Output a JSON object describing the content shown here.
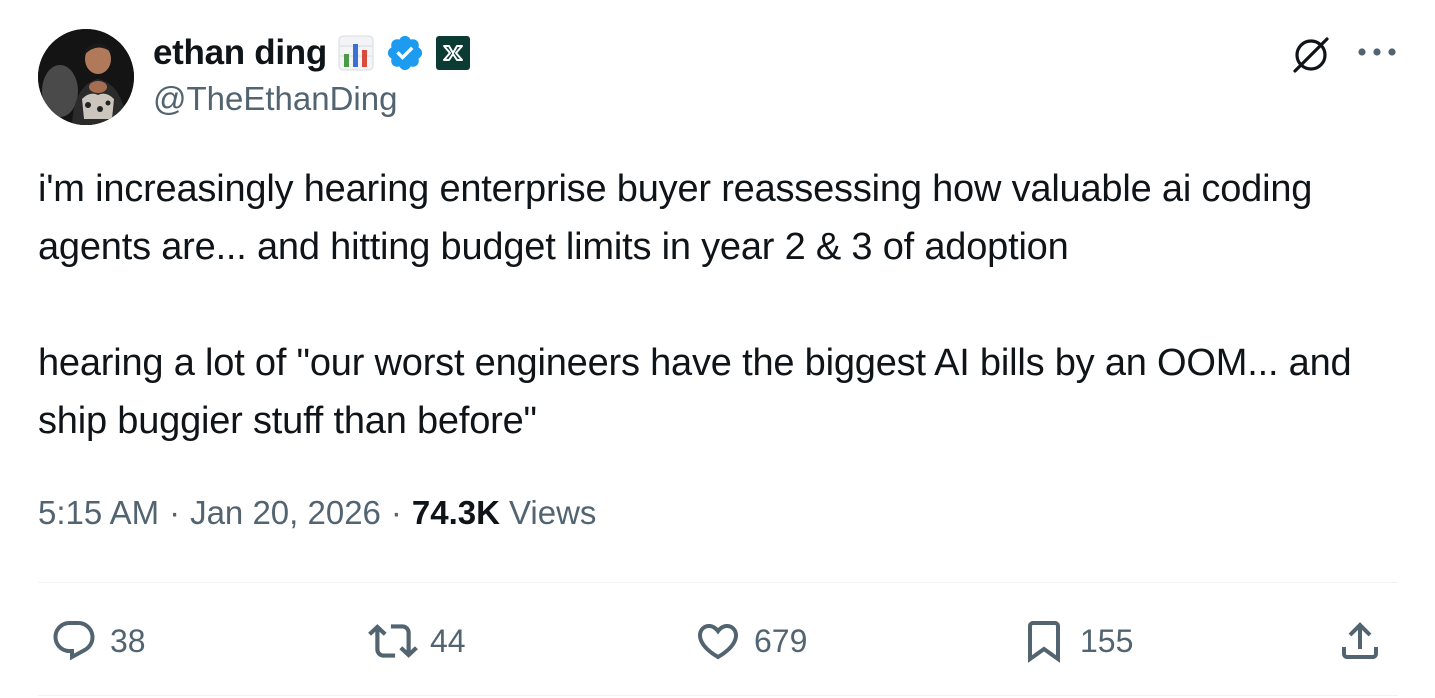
{
  "author": {
    "display_name": "ethan ding",
    "handle": "@TheEthanDing",
    "verified": true,
    "badges": [
      "bar-chart-emoji-icon",
      "verified-badge-icon",
      "affiliate-logo-icon"
    ]
  },
  "header_actions": {
    "grok_icon": "grok-icon",
    "more_icon": "more-icon"
  },
  "tweet": {
    "paragraphs": [
      "i'm increasingly hearing enterprise buyer reassessing how valuable ai coding agents are... and hitting budget limits in year 2 & 3 of adoption",
      "hearing a lot of \"our worst engineers have the biggest AI bills by an OOM... and ship buggier stuff than before\""
    ]
  },
  "meta": {
    "time": "5:15 AM",
    "separator": "·",
    "date": "Jan 20, 2026",
    "views_count": "74.3K",
    "views_label": "Views"
  },
  "actions": {
    "reply_count": "38",
    "repost_count": "44",
    "like_count": "679",
    "bookmark_count": "155"
  },
  "colors": {
    "text_primary": "#0f1419",
    "text_secondary": "#536471",
    "verified_blue": "#1d9bf0",
    "divider": "#eff3f4"
  }
}
